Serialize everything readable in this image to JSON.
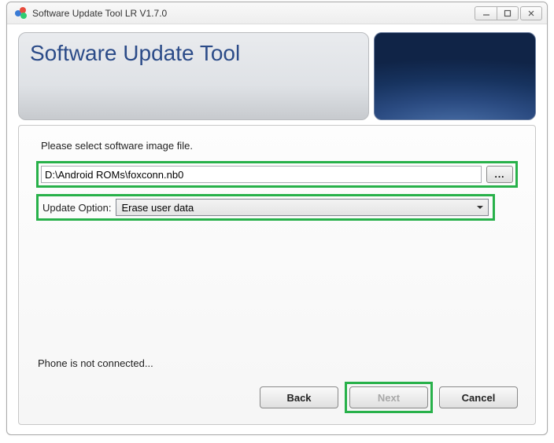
{
  "window": {
    "title": "Software Update Tool LR V1.7.0"
  },
  "header": {
    "title": "Software Update Tool"
  },
  "main": {
    "instruction": "Please select software image file.",
    "file_path": "D:\\Android ROMs\\foxconn.nb0",
    "browse_label": "...",
    "option_label": "Update Option:",
    "option_selected": "Erase user data",
    "status": "Phone is not connected..."
  },
  "buttons": {
    "back": "Back",
    "next": "Next",
    "cancel": "Cancel"
  },
  "highlight_color": "#28b14a"
}
